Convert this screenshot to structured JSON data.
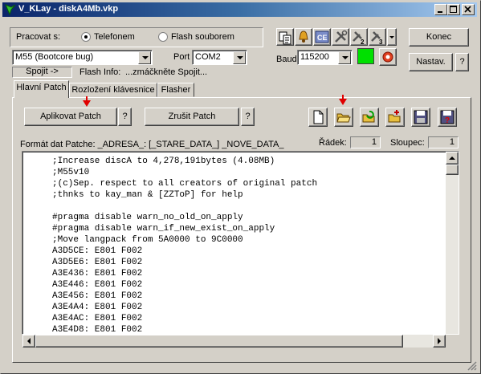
{
  "window": {
    "title": "V_KLay - diskA4Mb.vkp"
  },
  "connection": {
    "label": "Pracovat s:",
    "options": [
      "Telefonem",
      "Flash souborem"
    ],
    "selected": "Telefonem",
    "phone_model": "M55 (Bootcore bug)",
    "port_label": "Port",
    "port_value": "COM2",
    "baud_label": "Baud",
    "baud_value": "115200",
    "connect_button": "Spojit ->",
    "flash_info_label": "Flash Info:",
    "flash_info_value": "...zmáčkněte Spojit..."
  },
  "buttons": {
    "exit": "Konec",
    "settings": "Nastav.",
    "help": "?"
  },
  "status_color": "#00e000",
  "tabs": [
    "Hlavní Patch",
    "Rozložení klávesnice",
    "Flasher"
  ],
  "active_tab": "Hlavní Patch",
  "patch": {
    "apply_button": "Aplikovat Patch",
    "cancel_button": "Zrušit Patch",
    "help": "?",
    "format_label": "Formát dat Patche: _ADRESA_: [_STARE_DATA_] _NOVE_DATA_",
    "row_label": "Řádek:",
    "row_value": "1",
    "col_label": "Sloupec:",
    "col_value": "1"
  },
  "code_lines": [
    ";Increase discA to 4,278,191bytes (4.08MB)",
    ";M55v10",
    ";(c)Sep. respect to all creators of original patch",
    ";thnks to kay_man & [ZZToP] for help",
    "",
    "#pragma disable warn_no_old_on_apply",
    "#pragma disable warn_if_new_exist_on_apply",
    ";Move langpack from 5A0000 to 9C0000",
    "A3D5CE: E801 F002",
    "A3D5E6: E801 F002",
    "A3E436: E801 F002",
    "A3E446: E801 F002",
    "A3E456: E801 F002",
    "A3E4A4: E801 F002",
    "A3E4AC: E801 F002",
    "A3E4D8: E801 F002"
  ]
}
